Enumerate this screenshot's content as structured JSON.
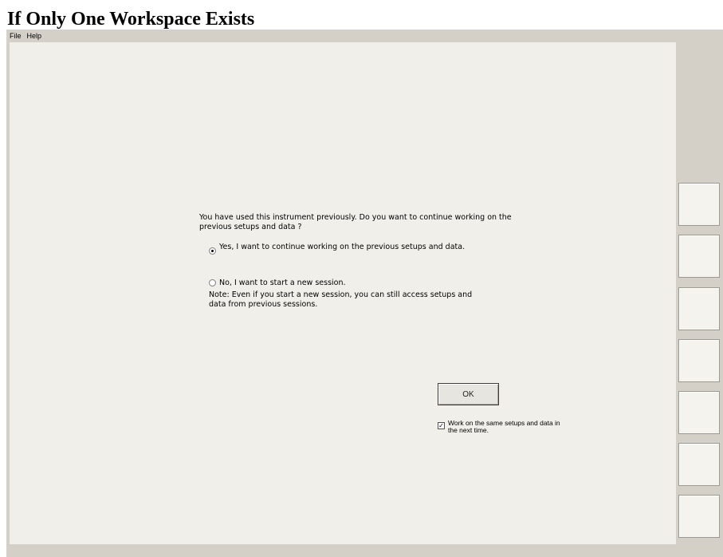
{
  "page_title": "If Only One Workspace Exists",
  "menubar": {
    "items": [
      "File",
      "Help"
    ]
  },
  "dialog": {
    "message": "You have used this instrument previously. Do you want to continue working on the previous setups and data ?",
    "options": [
      {
        "label": "Yes, I want to continue working on the previous setups and data.",
        "selected": true
      },
      {
        "label": "No, I want to start a new session.",
        "selected": false
      }
    ],
    "note": "Note: Even if you start a new session, you can still access setups and data from previous sessions.",
    "ok_label": "OK",
    "checkbox": {
      "label": "Work on the same setups and data in the next time.",
      "checked": true
    }
  },
  "side_buttons": {
    "count": 7
  },
  "colors": {
    "window_bg": "#d4d0c8",
    "panel_bg": "#f1efe9",
    "button_bg": "#f4f3ee"
  },
  "icons": {
    "radio_selected": "radio-selected-icon",
    "radio_unselected": "radio-unselected-icon",
    "checkbox_checked": "checkmark-icon"
  }
}
